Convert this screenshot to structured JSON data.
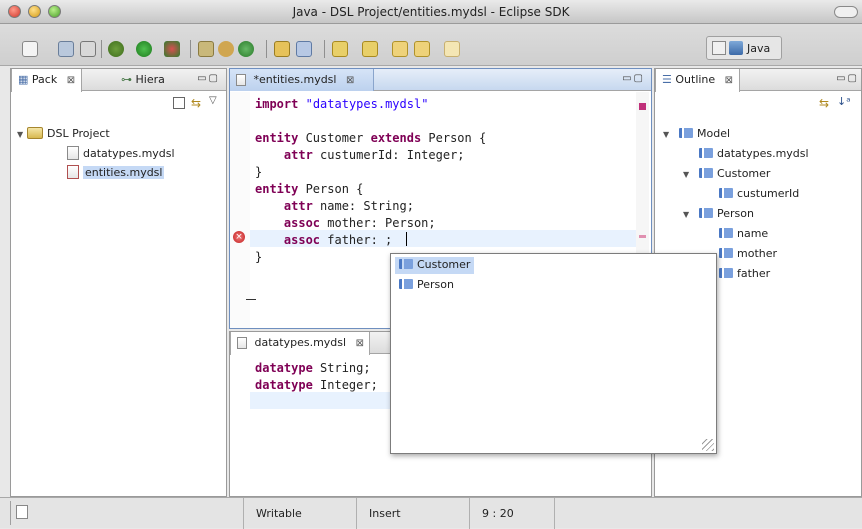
{
  "window": {
    "title": "Java - DSL Project/entities.mydsl - Eclipse SDK"
  },
  "perspective": {
    "label": "Java"
  },
  "package_explorer": {
    "tab_pack": "Pack",
    "tab_hiera": "Hiera",
    "tree": [
      {
        "label": "DSL Project",
        "type": "project"
      },
      {
        "label": "datatypes.mydsl",
        "type": "file"
      },
      {
        "label": "entities.mydsl",
        "type": "file-error",
        "selected": true
      }
    ]
  },
  "editor_main": {
    "tab_label": "*entities.mydsl",
    "lines": [
      {
        "parts": [
          [
            "kw",
            "import"
          ],
          [
            "plain",
            " "
          ],
          [
            "str",
            "\"datatypes.mydsl\""
          ]
        ]
      },
      {
        "parts": []
      },
      {
        "parts": [
          [
            "kw",
            "entity"
          ],
          [
            "plain",
            " Customer "
          ],
          [
            "kw",
            "extends"
          ],
          [
            "plain",
            " Person {"
          ]
        ]
      },
      {
        "parts": [
          [
            "plain",
            "    "
          ],
          [
            "kw",
            "attr"
          ],
          [
            "plain",
            " custumerId: Integer;"
          ]
        ]
      },
      {
        "parts": [
          [
            "plain",
            "}"
          ]
        ]
      },
      {
        "parts": [
          [
            "kw",
            "entity"
          ],
          [
            "plain",
            " Person {"
          ]
        ]
      },
      {
        "parts": [
          [
            "plain",
            "    "
          ],
          [
            "kw",
            "attr"
          ],
          [
            "plain",
            " name: String;"
          ]
        ]
      },
      {
        "parts": [
          [
            "plain",
            "    "
          ],
          [
            "kw",
            "assoc"
          ],
          [
            "plain",
            " mother: Person;"
          ]
        ]
      },
      {
        "parts": [
          [
            "plain",
            "    "
          ],
          [
            "kw",
            "assoc"
          ],
          [
            "plain",
            " father: ;"
          ]
        ]
      },
      {
        "parts": [
          [
            "plain",
            "}"
          ]
        ]
      }
    ]
  },
  "editor_secondary": {
    "tab_label": "datatypes.mydsl",
    "lines": [
      {
        "parts": [
          [
            "kw",
            "datatype"
          ],
          [
            "plain",
            " String;"
          ]
        ]
      },
      {
        "parts": [
          [
            "kw",
            "datatype"
          ],
          [
            "plain",
            " Integer;"
          ]
        ]
      }
    ]
  },
  "content_assist": {
    "items": [
      {
        "label": "Customer",
        "selected": true
      },
      {
        "label": "Person",
        "selected": false
      }
    ]
  },
  "outline": {
    "tab_label": "Outline",
    "tree": [
      {
        "label": "Model",
        "depth": 0,
        "expand": true
      },
      {
        "label": "datatypes.mydsl",
        "depth": 1,
        "expand": false
      },
      {
        "label": "Customer",
        "depth": 1,
        "expand": true
      },
      {
        "label": "custumerId",
        "depth": 2,
        "expand": false
      },
      {
        "label": "Person",
        "depth": 1,
        "expand": true
      },
      {
        "label": "name",
        "depth": 2,
        "expand": false
      },
      {
        "label": "mother",
        "depth": 2,
        "expand": false
      },
      {
        "label": "father",
        "depth": 2,
        "expand": false
      }
    ]
  },
  "statusbar": {
    "writable": "Writable",
    "insert_mode": "Insert",
    "position": "9 : 20"
  }
}
